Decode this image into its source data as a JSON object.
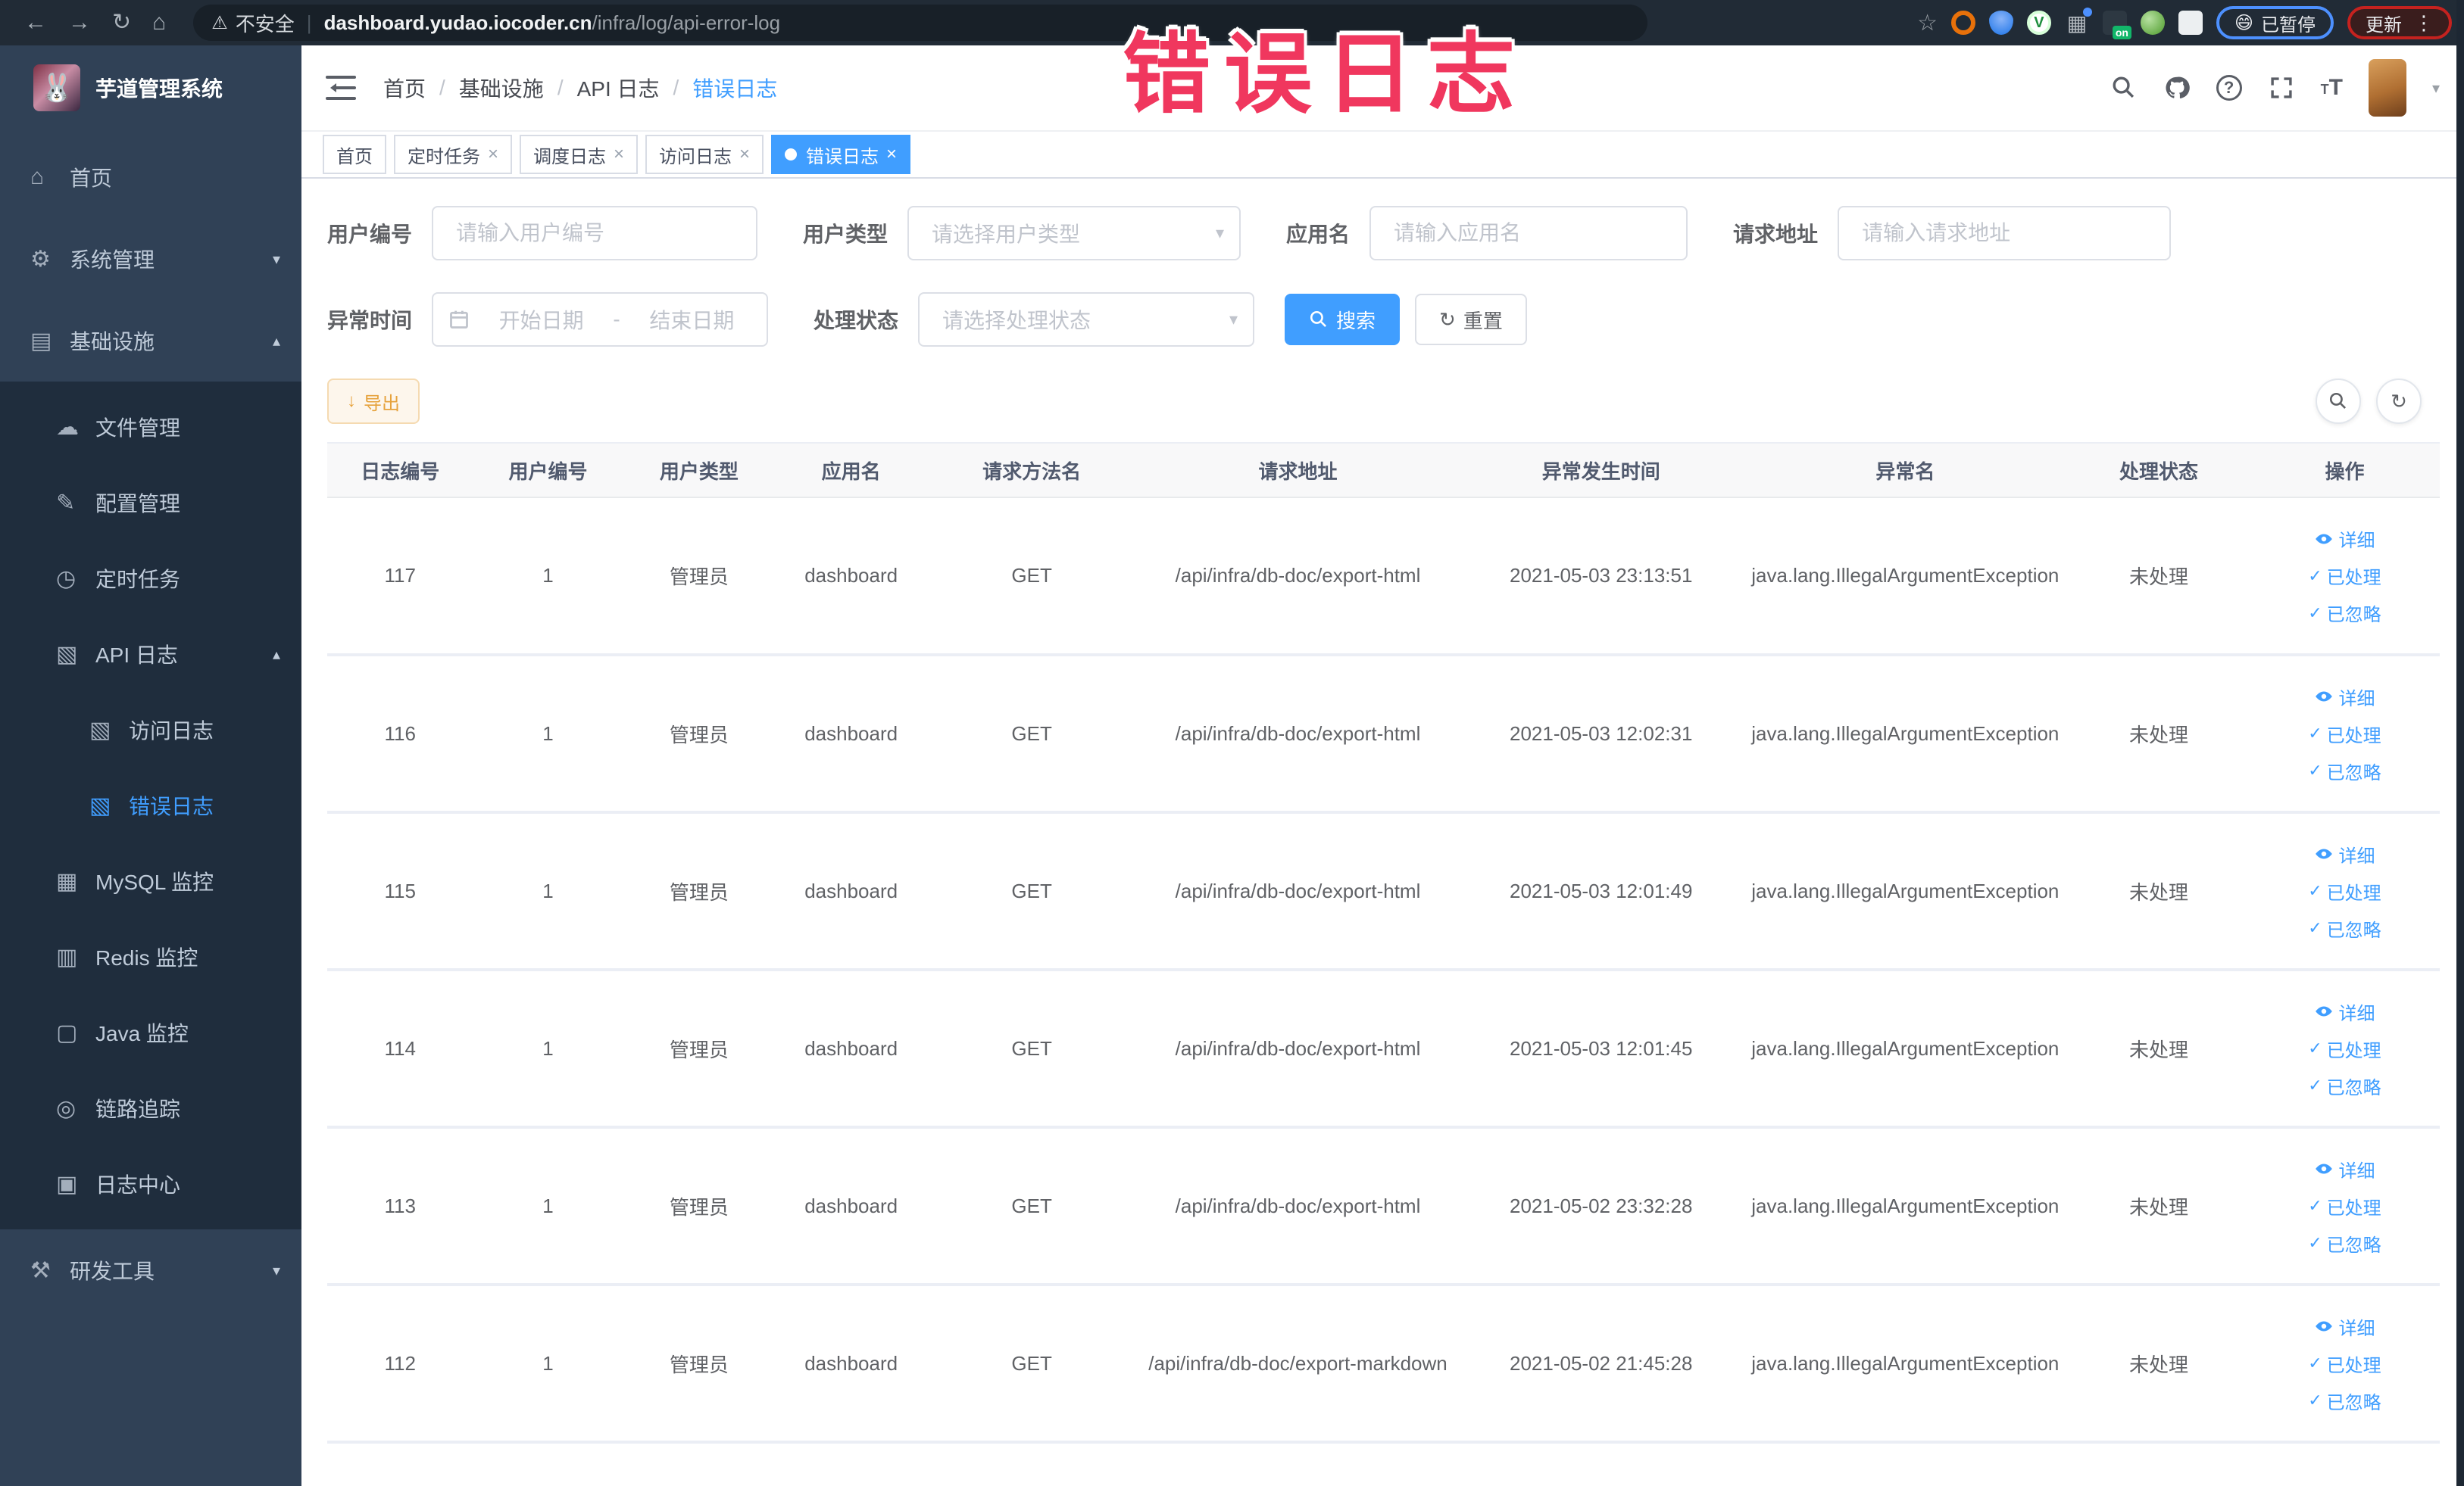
{
  "browser": {
    "security_label": "不安全",
    "url_domain": "dashboard.yudao.iocoder.cn",
    "url_path": "/infra/log/api-error-log",
    "paused_label": "已暂停",
    "paused_emoji": "😄",
    "update_label": "更新"
  },
  "annotation": {
    "text": "错误日志"
  },
  "icons": {
    "back": "←",
    "forward": "→",
    "reload": "↻",
    "home": "⌂",
    "warning": "⚠",
    "separator": "|",
    "star": "☆",
    "kebab": "⋮",
    "grid": "▦",
    "on_badge": "on",
    "ext_v": "V",
    "question": "?",
    "font_big": "T",
    "font_small": "T",
    "caret_down": "▾",
    "chevron_up": "▴",
    "chevron_down": "▾",
    "close": "×",
    "check": "✓",
    "refresh": "↻",
    "download": "↓",
    "dash": "-"
  },
  "sidebar": {
    "title": "芋道管理系统",
    "logo_emoji": "🐰",
    "home": {
      "label": "首页",
      "glyph": "⌂"
    },
    "system": {
      "label": "系统管理",
      "glyph": "⚙"
    },
    "infra": {
      "label": "基础设施",
      "glyph": "▤"
    },
    "file": {
      "label": "文件管理",
      "glyph": "☁"
    },
    "config": {
      "label": "配置管理",
      "glyph": "✎"
    },
    "job": {
      "label": "定时任务",
      "glyph": "◷"
    },
    "apilog": {
      "label": "API 日志",
      "glyph": "▧"
    },
    "accesslog": {
      "label": "访问日志",
      "glyph": "▧"
    },
    "errorlog": {
      "label": "错误日志",
      "glyph": "▧"
    },
    "mysql": {
      "label": "MySQL 监控",
      "glyph": "▦"
    },
    "redis": {
      "label": "Redis 监控",
      "glyph": "▥"
    },
    "java": {
      "label": "Java 监控",
      "glyph": "▢"
    },
    "trace": {
      "label": "链路追踪",
      "glyph": "◎"
    },
    "logcenter": {
      "label": "日志中心",
      "glyph": "▣"
    },
    "devtools": {
      "label": "研发工具",
      "glyph": "⚒"
    }
  },
  "navbar": {
    "breadcrumb": [
      "首页",
      "基础设施",
      "API 日志",
      "错误日志"
    ],
    "separator": "/"
  },
  "tabs": [
    {
      "label": "首页"
    },
    {
      "label": "定时任务"
    },
    {
      "label": "调度日志"
    },
    {
      "label": "访问日志"
    },
    {
      "label": "错误日志"
    }
  ],
  "filters": {
    "user_id": {
      "label": "用户编号",
      "placeholder": "请输入用户编号"
    },
    "user_type": {
      "label": "用户类型",
      "placeholder": "请选择用户类型"
    },
    "app_name": {
      "label": "应用名",
      "placeholder": "请输入应用名"
    },
    "request_url": {
      "label": "请求地址",
      "placeholder": "请输入请求地址"
    },
    "exception_time": {
      "label": "异常时间",
      "start_placeholder": "开始日期",
      "end_placeholder": "结束日期"
    },
    "process_status": {
      "label": "处理状态",
      "placeholder": "请选择处理状态"
    },
    "search_label": "搜索",
    "reset_label": "重置"
  },
  "toolbar": {
    "export_label": "导出"
  },
  "table": {
    "headers": [
      "日志编号",
      "用户编号",
      "用户类型",
      "应用名",
      "请求方法名",
      "请求地址",
      "异常发生时间",
      "异常名",
      "处理状态",
      "操作"
    ],
    "actions": {
      "detail": "详细",
      "processed": "已处理",
      "ignored": "已忽略"
    },
    "rows": [
      {
        "id": "117",
        "user_id": "1",
        "user_type": "管理员",
        "app": "dashboard",
        "method": "GET",
        "url": "/api/infra/db-doc/export-html",
        "time": "2021-05-03 23:13:51",
        "exception": "java.lang.IllegalArgumentException",
        "status": "未处理"
      },
      {
        "id": "116",
        "user_id": "1",
        "user_type": "管理员",
        "app": "dashboard",
        "method": "GET",
        "url": "/api/infra/db-doc/export-html",
        "time": "2021-05-03 12:02:31",
        "exception": "java.lang.IllegalArgumentException",
        "status": "未处理"
      },
      {
        "id": "115",
        "user_id": "1",
        "user_type": "管理员",
        "app": "dashboard",
        "method": "GET",
        "url": "/api/infra/db-doc/export-html",
        "time": "2021-05-03 12:01:49",
        "exception": "java.lang.IllegalArgumentException",
        "status": "未处理"
      },
      {
        "id": "114",
        "user_id": "1",
        "user_type": "管理员",
        "app": "dashboard",
        "method": "GET",
        "url": "/api/infra/db-doc/export-html",
        "time": "2021-05-03 12:01:45",
        "exception": "java.lang.IllegalArgumentException",
        "status": "未处理"
      },
      {
        "id": "113",
        "user_id": "1",
        "user_type": "管理员",
        "app": "dashboard",
        "method": "GET",
        "url": "/api/infra/db-doc/export-html",
        "time": "2021-05-02 23:32:28",
        "exception": "java.lang.IllegalArgumentException",
        "status": "未处理"
      },
      {
        "id": "112",
        "user_id": "1",
        "user_type": "管理员",
        "app": "dashboard",
        "method": "GET",
        "url": "/api/infra/db-doc/export-markdown",
        "time": "2021-05-02 21:45:28",
        "exception": "java.lang.IllegalArgumentException",
        "status": "未处理"
      }
    ]
  }
}
